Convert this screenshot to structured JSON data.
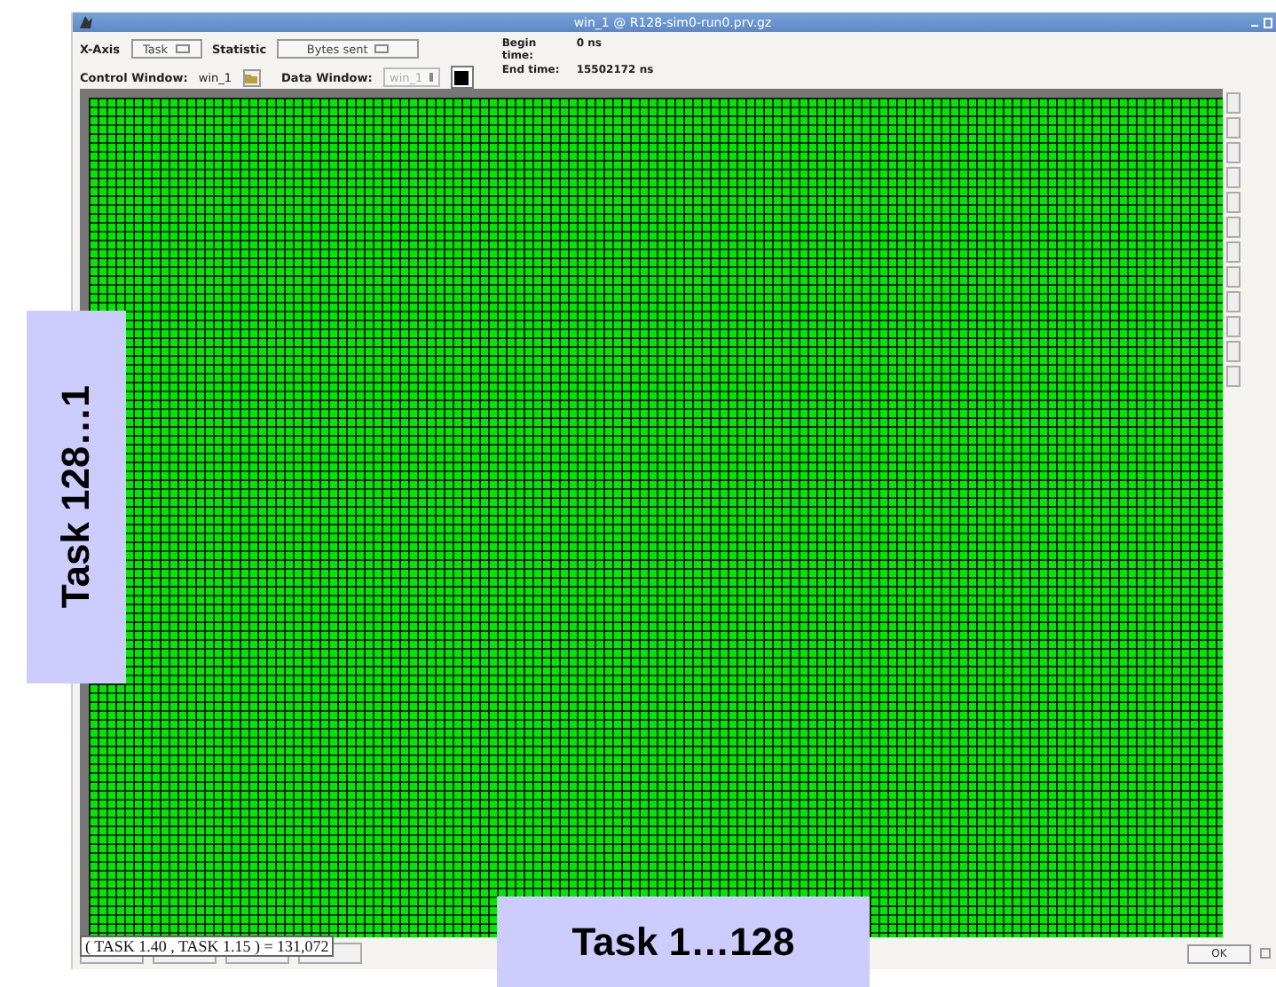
{
  "window": {
    "title": "win_1 @ R128-sim0-run0.prv.gz"
  },
  "controls": {
    "x_axis": {
      "label": "X-Axis",
      "value": "Task"
    },
    "statistic": {
      "label": "Statistic",
      "value": "Bytes sent"
    },
    "control_window": {
      "label": "Control Window:",
      "value": "win_1"
    },
    "data_window": {
      "label": "Data Window:",
      "value": "win_1",
      "disabled": true
    }
  },
  "times": [
    {
      "label": "Begin time:",
      "value": "0 ns"
    },
    {
      "label": "End time:",
      "value": "15502172 ns"
    }
  ],
  "tooltip": "( TASK 1.40 , TASK 1.15 ) = 131,072",
  "ok_button": "OK",
  "annotations": {
    "y_label": "Task 128…1",
    "x_label": "Task 1…128"
  }
}
